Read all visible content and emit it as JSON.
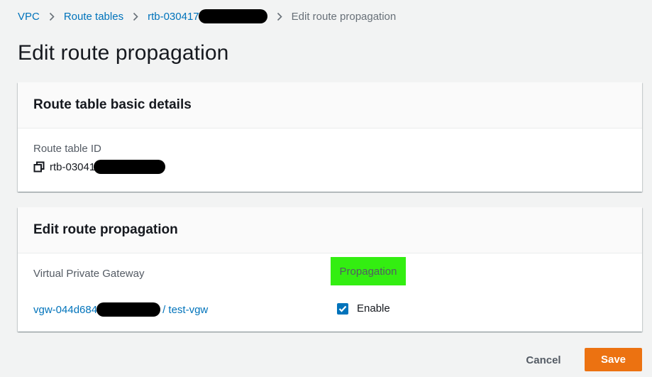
{
  "breadcrumb": {
    "items": [
      "VPC",
      "Route tables",
      "rtb-030417"
    ],
    "current": "Edit route propagation"
  },
  "page": {
    "title": "Edit route propagation"
  },
  "details_panel": {
    "header": "Route table basic details",
    "route_table_id_label": "Route table ID",
    "route_table_id_value": "rtb-03041"
  },
  "propagation_panel": {
    "header": "Edit route propagation",
    "col_gateway": "Virtual Private Gateway",
    "col_propagation": "Propagation",
    "rows": [
      {
        "gateway_id": "vgw-044d684",
        "gateway_name": "/ test-vgw",
        "enable_label": "Enable",
        "enabled": true
      }
    ]
  },
  "footer": {
    "cancel_label": "Cancel",
    "save_label": "Save"
  },
  "colors": {
    "link": "#0073bb",
    "primary_button": "#ec7211",
    "highlight": "#33ee11",
    "background": "#f2f3f3"
  },
  "icons": [
    "chevron-right-icon",
    "copy-icon",
    "checkmark-icon"
  ]
}
